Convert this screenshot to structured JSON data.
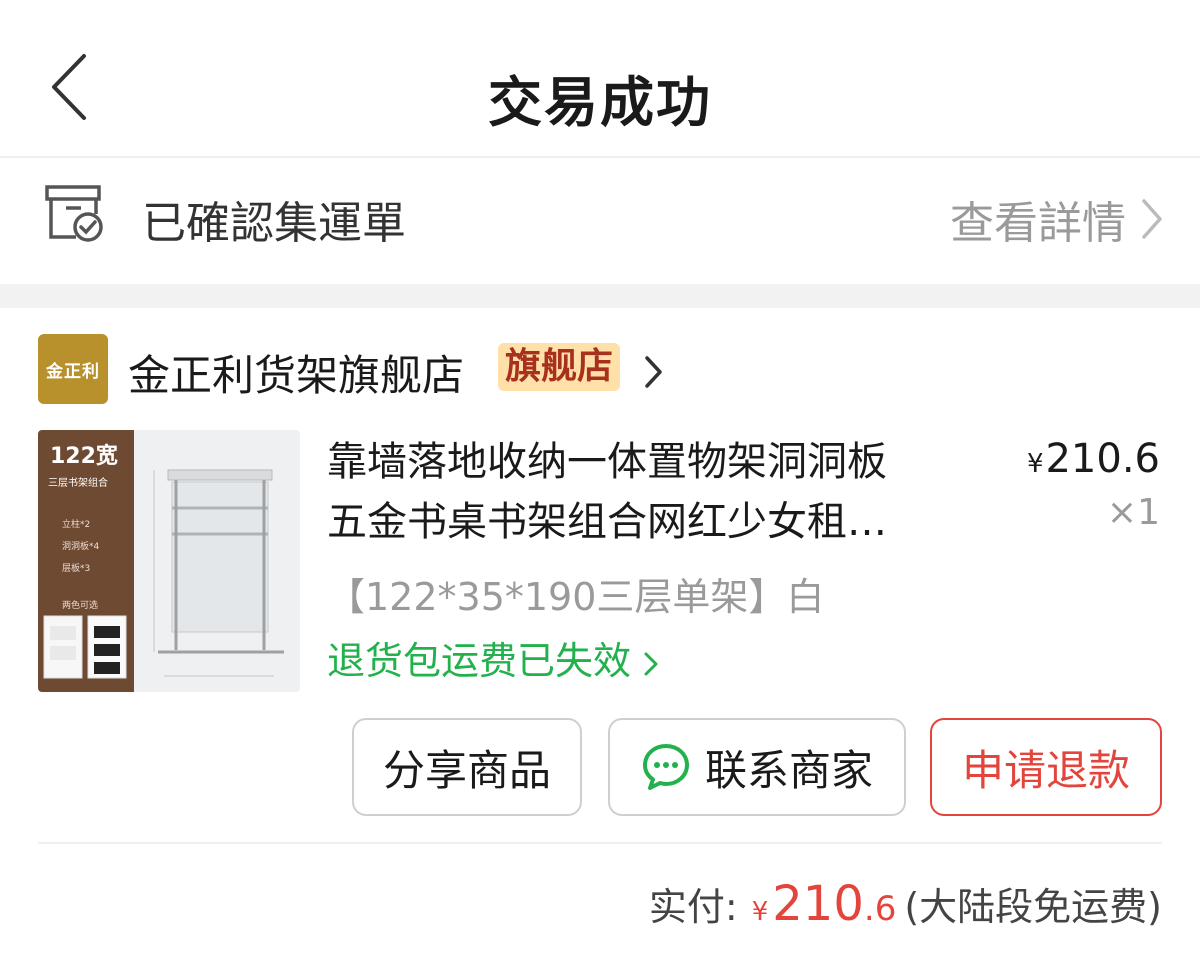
{
  "header": {
    "title": "交易成功"
  },
  "logistics": {
    "status": "已確認集運單",
    "detail_link": "查看詳情"
  },
  "shop": {
    "logo_text": "金正利",
    "name": "金正利货架旗舰店",
    "badge": "旗舰店"
  },
  "product": {
    "title_line1": "靠墙落地收纳一体置物架洞洞板",
    "title_line2": "五金书桌书架组合网红少女租…",
    "price_currency": "¥",
    "price": "210.6",
    "quantity": "×1",
    "sku": "【122*35*190三层单架】白",
    "freight_notice": "退货包运费已失效",
    "thumb": {
      "size_label": "122宽",
      "subtitle": "三层书架组合",
      "parts": [
        "立柱*2",
        "洞洞板*4",
        "层板*3"
      ],
      "colors_label": "两色可选"
    }
  },
  "actions": {
    "share": "分享商品",
    "contact": "联系商家",
    "refund": "申请退款"
  },
  "payment": {
    "label": "实付:",
    "currency": "¥",
    "amount_int": "210",
    "amount_dec": ".6",
    "note": "(大陆段免运费)"
  },
  "colors": {
    "accent_red": "#e3453c",
    "green": "#22b14c",
    "badge_bg": "#ffe0a8",
    "shop_logo_bg": "#b8902c"
  }
}
